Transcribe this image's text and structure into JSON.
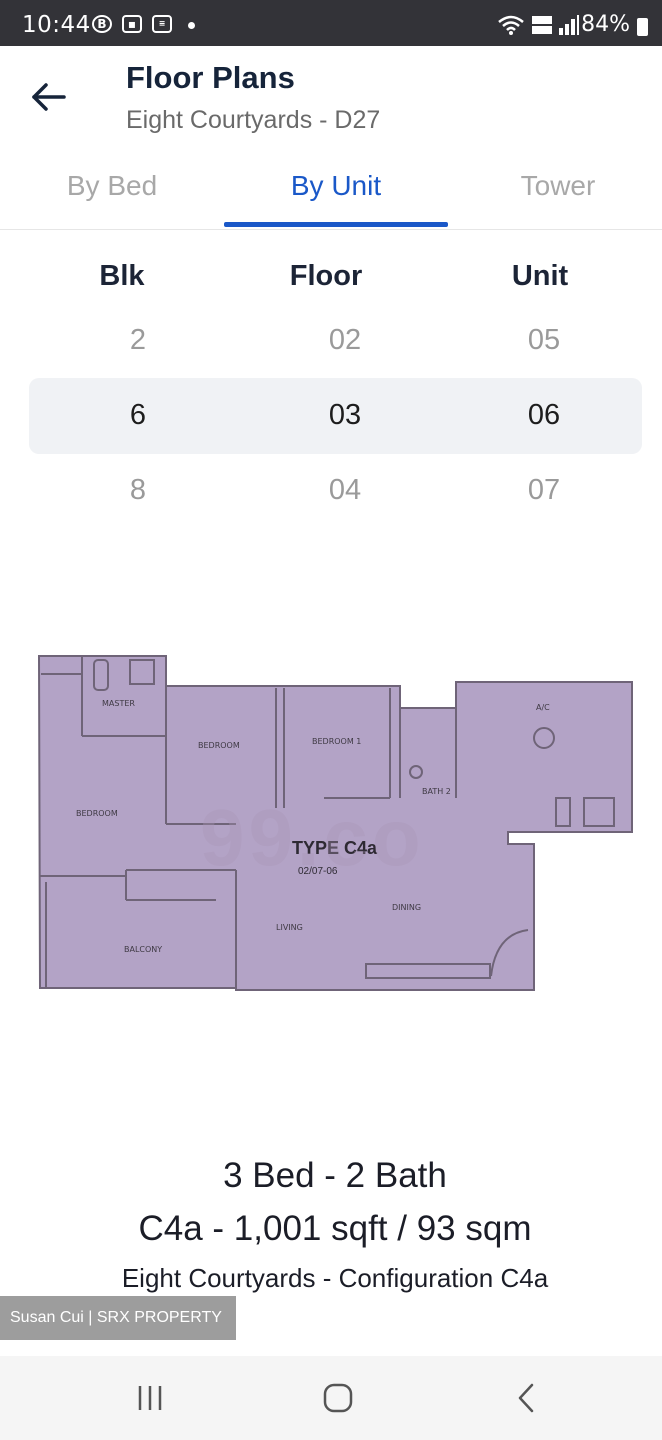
{
  "status_bar": {
    "time": "10:44",
    "battery": "84%",
    "icons": [
      "b-badge-icon",
      "image-icon",
      "app-icon",
      "dot-icon",
      "wifi-icon",
      "volte-icon",
      "signal-icon",
      "battery-icon"
    ]
  },
  "header": {
    "title": "Floor Plans",
    "subtitle": "Eight Courtyards - D27"
  },
  "tabs": [
    {
      "label": "By Bed",
      "active": false
    },
    {
      "label": "By Unit",
      "active": true
    },
    {
      "label": "Tower",
      "active": false
    }
  ],
  "picker": {
    "headers": {
      "blk": "Blk",
      "floor": "Floor",
      "unit": "Unit"
    },
    "blk": {
      "prev": "2",
      "selected": "6",
      "next": "8"
    },
    "floor": {
      "prev": "02",
      "selected": "03",
      "next": "04"
    },
    "unit": {
      "prev": "05",
      "selected": "06",
      "next": "07"
    }
  },
  "floor_plan": {
    "type_label": "TYPE C4a",
    "units_label": "02/07-06",
    "rooms": [
      "MASTER",
      "BEDROOM",
      "BEDROOM 1",
      "BATH 2",
      "BEDROOM",
      "LIVING",
      "DINING",
      "BALCONY",
      "A/C"
    ],
    "watermark": "99.co",
    "fill_color": "#b3a3c6"
  },
  "summary": {
    "beds_baths": "3 Bed - 2 Bath",
    "size": "C4a - 1,001 sqft / 93 sqm",
    "configuration": "Eight Courtyards - Configuration C4a"
  },
  "agent_tag": "Susan Cui | SRX PROPERTY",
  "accent_color": "#1a58c8"
}
